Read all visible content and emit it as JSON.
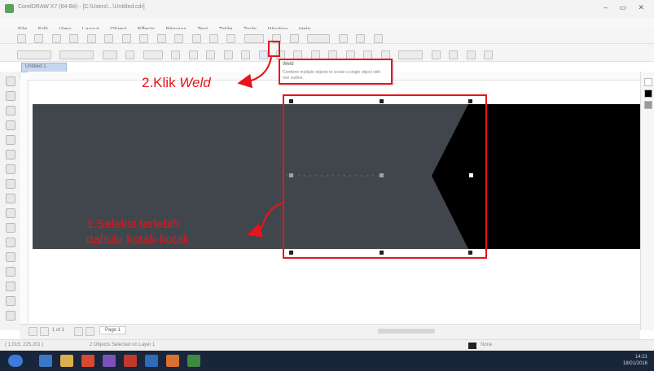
{
  "window": {
    "title": "CorelDRAW X7 (64-Bit) - [C:\\Users\\...\\Untitled.cdr]",
    "controls": "–  ▭  ✕"
  },
  "menubar": {
    "items": [
      "File",
      "Edit",
      "View",
      "Layout",
      "Object",
      "Effects",
      "Bitmaps",
      "Text",
      "Table",
      "Tools",
      "Window",
      "Help"
    ]
  },
  "document": {
    "tab_label": "Untitled-1"
  },
  "tooltip": {
    "title": "Weld",
    "description": "Combine multiple objects to create a single object with one outline."
  },
  "annotations": {
    "step1_line1": "1.Seleksi terlebih",
    "step1_line2": "dahulu kotak-kotak",
    "step2_prefix": "2.Klik ",
    "step2_emph": "Weld"
  },
  "pagebar": {
    "page_counter": "1 of 1",
    "page_tab": "Page 1"
  },
  "statusbar": {
    "coords": "( 1,015; 225,201 )",
    "info": "2 Objects Selected on Layer 1",
    "fill": "None"
  },
  "taskbar": {
    "time": "14:21",
    "date": "18/01/2016"
  },
  "colors": {
    "annotation_red": "#e8141b",
    "shape_dark_gray": "#41464c",
    "shape_black": "#000000",
    "taskbar_bg": "#18253b"
  }
}
